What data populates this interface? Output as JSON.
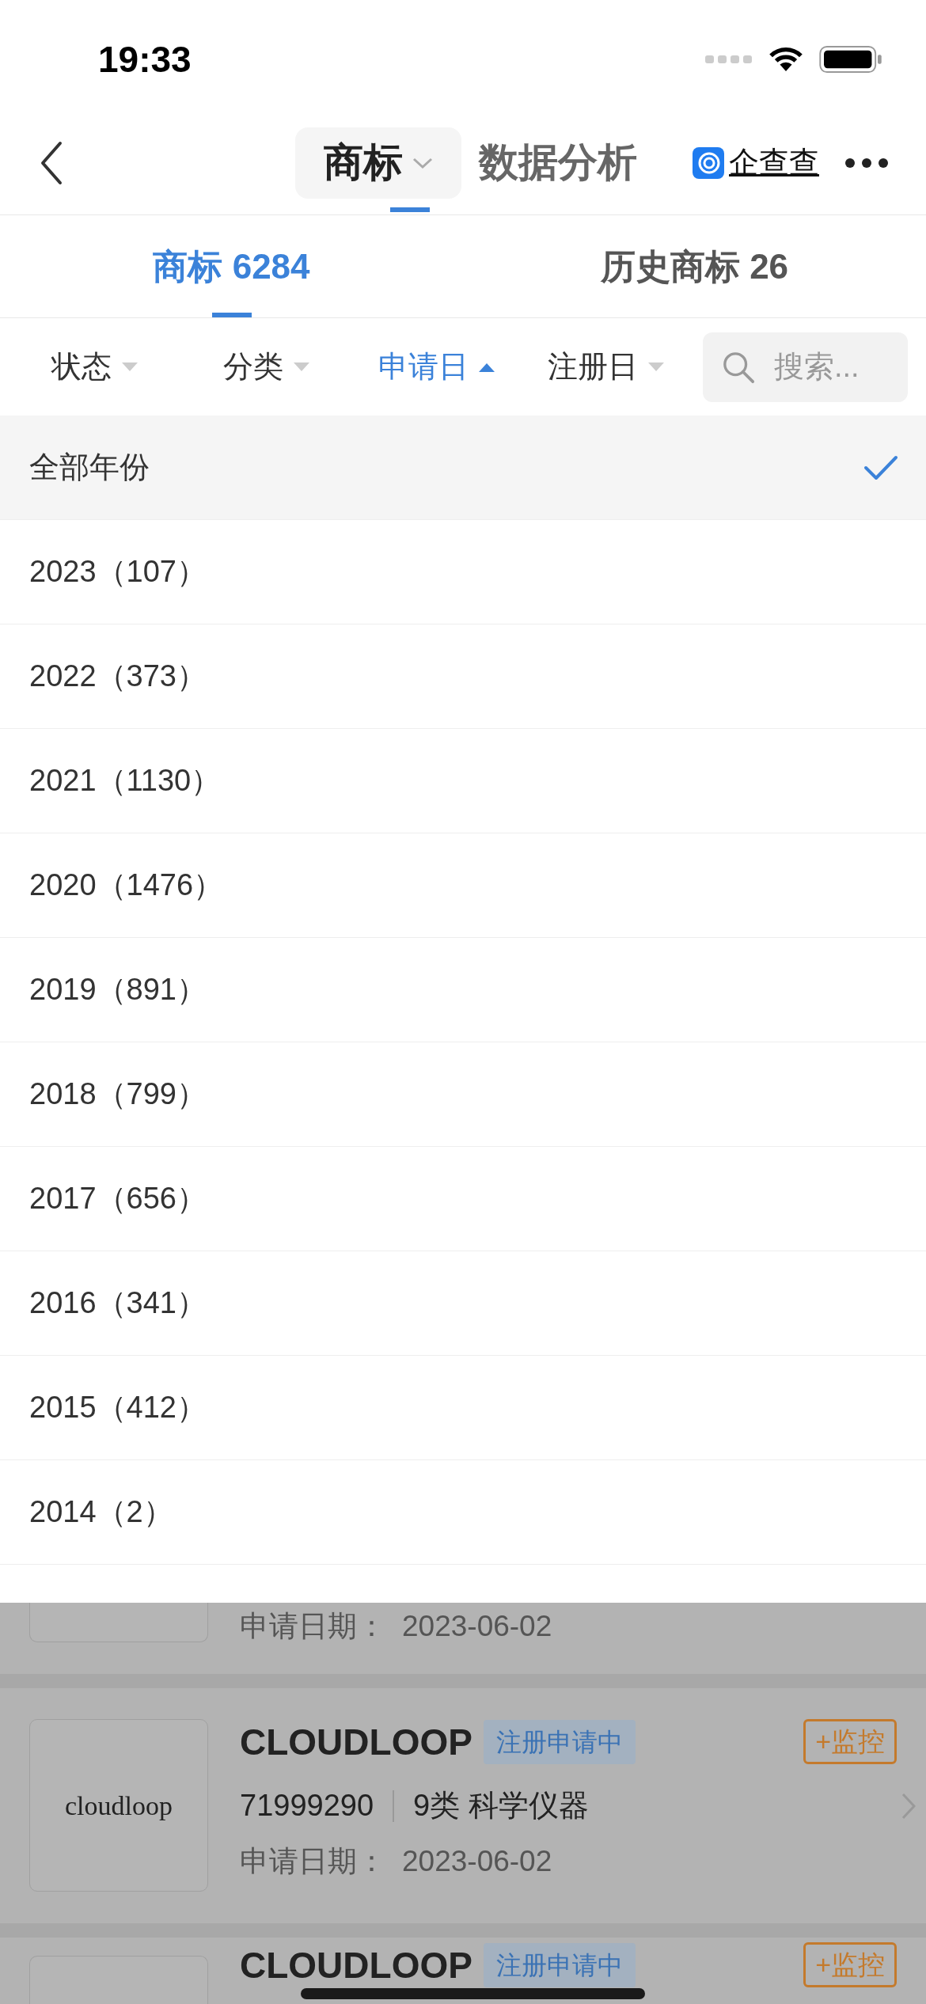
{
  "status_bar": {
    "time": "19:33"
  },
  "nav": {
    "tabs": [
      {
        "label": "商标",
        "selected": true
      },
      {
        "label": "数据分析",
        "selected": false
      }
    ],
    "brand": "企查查"
  },
  "tabs": [
    {
      "label": "商标 6284",
      "selected": true
    },
    {
      "label": "历史商标 26",
      "selected": false
    }
  ],
  "filters": [
    {
      "label": "状态",
      "selected": false
    },
    {
      "label": "分类",
      "selected": false
    },
    {
      "label": "申请日",
      "selected": true
    },
    {
      "label": "注册日",
      "selected": false
    }
  ],
  "search": {
    "placeholder": "搜索..."
  },
  "year_options": [
    {
      "label": "全部年份",
      "selected": true
    },
    {
      "label": "2023（107）",
      "selected": false
    },
    {
      "label": "2022（373）",
      "selected": false
    },
    {
      "label": "2021（1130）",
      "selected": false
    },
    {
      "label": "2020（1476）",
      "selected": false
    },
    {
      "label": "2019（891）",
      "selected": false
    },
    {
      "label": "2018（799）",
      "selected": false
    },
    {
      "label": "2017（656）",
      "selected": false
    },
    {
      "label": "2016（341）",
      "selected": false
    },
    {
      "label": "2015（412）",
      "selected": false
    },
    {
      "label": "2014（2）",
      "selected": false
    }
  ],
  "cards": [
    {
      "kind": "bottom",
      "date_label": "申请日期：",
      "date": "2023-06-02"
    },
    {
      "kind": "full",
      "logo_text": "cloudloop",
      "title": "CLOUDLOOP",
      "status": "注册申请中",
      "action": "+监控",
      "number": "71999290",
      "class": "9类 科学仪器",
      "date_label": "申请日期：",
      "date": "2023-06-02"
    },
    {
      "kind": "top",
      "title": "CLOUDLOOP",
      "status": "注册申请中",
      "action": "+监控"
    }
  ]
}
